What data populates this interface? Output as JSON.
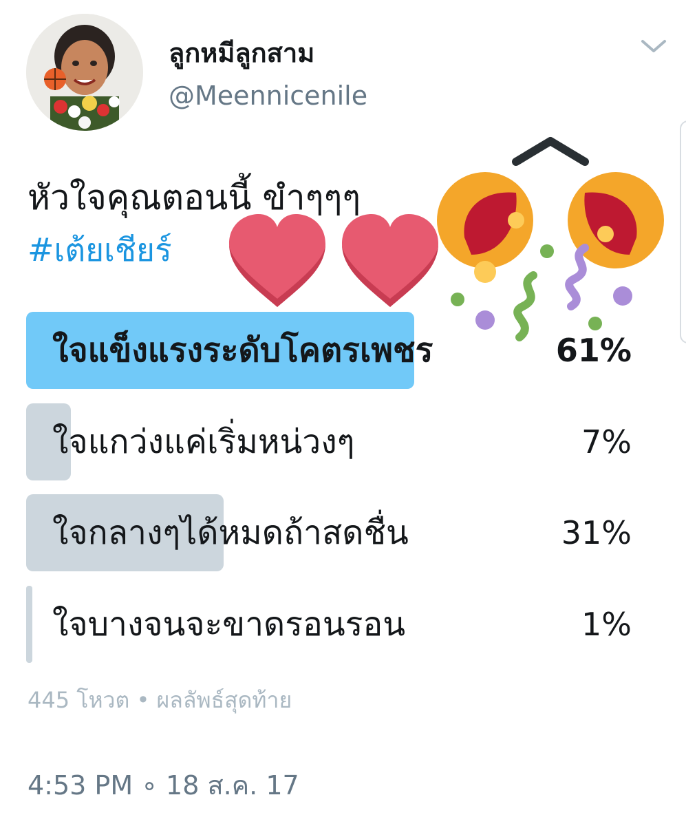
{
  "user": {
    "display_name": "ลูกหมีลูกสาม",
    "handle": "@Meennicenile"
  },
  "tweet": {
    "text": "หัวใจคุณตอนนี้ ขำๆๆๆ",
    "hashtag": "#เต้ยเชียร์",
    "emojis": [
      "heart-icon",
      "heart-icon",
      "party-popper-icon"
    ]
  },
  "poll": {
    "options": [
      {
        "label": "ใจแข็งแรงระดับโคตรเพชร",
        "percent_text": "61%",
        "percent": 61,
        "winner": true
      },
      {
        "label": "ใจแกว่งแค่เริ่มหน่วงๆ",
        "percent_text": "7%",
        "percent": 7,
        "winner": false
      },
      {
        "label": "ใจกลางๆได้หมดถ้าสดชื่น",
        "percent_text": "31%",
        "percent": 31,
        "winner": false
      },
      {
        "label": "ใจบางจนจะขาดรอนรอน",
        "percent_text": "1%",
        "percent": 1,
        "winner": false
      }
    ],
    "meta": "445 โหวต • ผลลัพธ์สุดท้าย"
  },
  "timestamp": "4:53 PM ∘ 18 ส.ค. 17",
  "colors": {
    "winner_bar": "#71c9f8",
    "bar": "#ccd6dd",
    "hashtag": "#1b95e0",
    "handle": "#657786",
    "meta": "#aab8c2",
    "heart": "#e75a70"
  },
  "icons": {
    "menu": "chevron-down-icon"
  }
}
